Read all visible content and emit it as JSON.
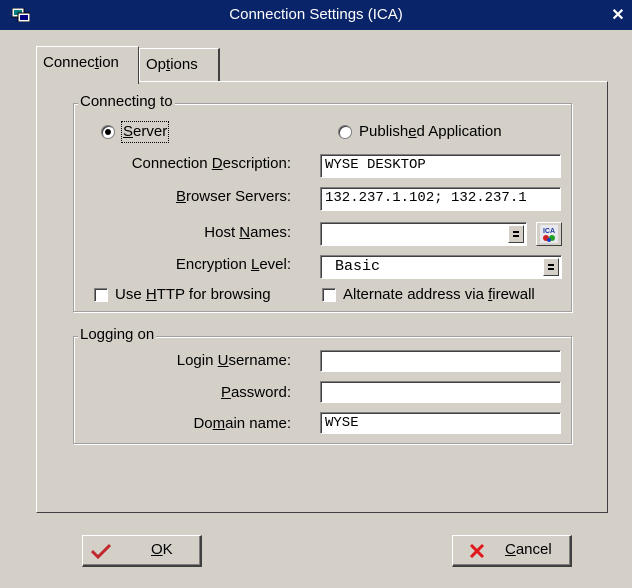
{
  "window": {
    "title": "Connection Settings (ICA)"
  },
  "tabs": [
    {
      "pre": "Connec",
      "key": "t",
      "post": "ion"
    },
    {
      "pre": "Op",
      "key": "t",
      "post": "ions"
    }
  ],
  "connecting": {
    "legend": "Connecting to",
    "server_radio": {
      "pre": "",
      "key": "S",
      "post": "erver",
      "selected": true
    },
    "published_radio": {
      "pre": "Publish",
      "key": "e",
      "post": "d Application",
      "selected": false
    },
    "description": {
      "pre": "Connection ",
      "key": "D",
      "post": "escription:",
      "value": "WYSE DESKTOP"
    },
    "browser_servers": {
      "pre": "",
      "key": "B",
      "post": "rowser Servers:",
      "value": "132.237.1.102; 132.237.1"
    },
    "host_names": {
      "pre": "Host ",
      "key": "N",
      "post": "ames:",
      "value": ""
    },
    "encryption": {
      "pre": "Encryption ",
      "key": "L",
      "post": "evel:",
      "value": "Basic"
    },
    "use_http": {
      "pre": "Use ",
      "key": "H",
      "post": "TTP for browsing",
      "checked": false
    },
    "alt_address": {
      "pre": "Alternate address via ",
      "key": "f",
      "post": "irewall",
      "checked": false
    },
    "ica_icon_text": "ICA"
  },
  "logon": {
    "legend": "Logging on",
    "username": {
      "pre": "Login ",
      "key": "U",
      "post": "sername:",
      "value": ""
    },
    "password": {
      "pre": "",
      "key": "P",
      "post": "assword:",
      "value": ""
    },
    "domain": {
      "pre": "Do",
      "key": "m",
      "post": "ain name:",
      "value": "WYSE"
    }
  },
  "buttons": {
    "ok": {
      "pre": "",
      "key": "O",
      "post": "K"
    },
    "cancel": {
      "pre": "",
      "key": "C",
      "post": "ancel"
    }
  },
  "colors": {
    "titlebar": "#0a246a",
    "face": "#d4d0c8",
    "ok_check": "#c0282d",
    "cancel_x": "#e0181c"
  }
}
